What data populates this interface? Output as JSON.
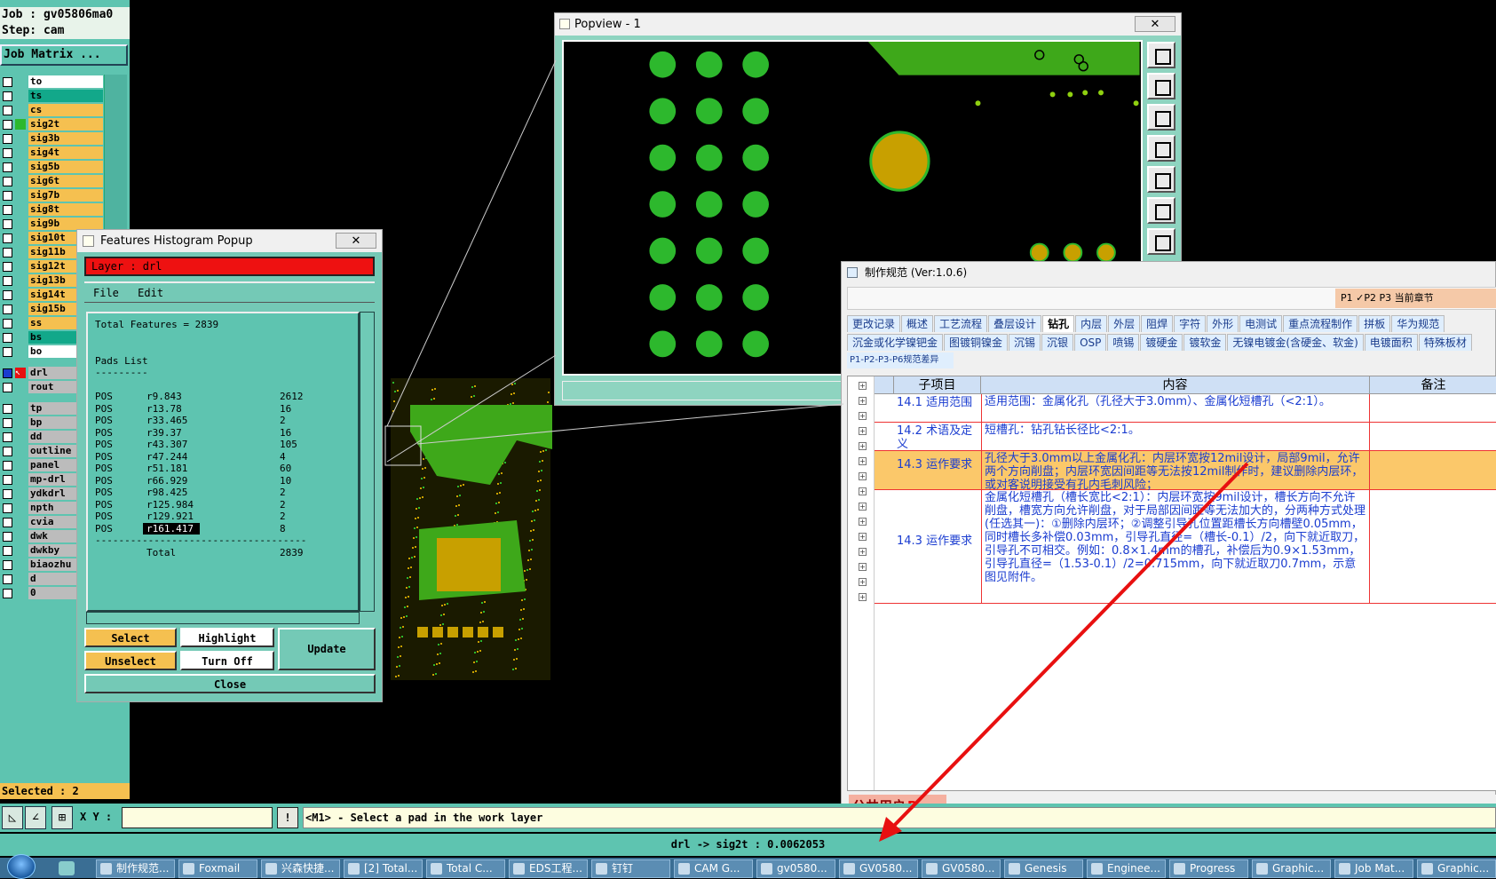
{
  "job": {
    "line1": "Job : gv05806ma0",
    "line2": "Step: cam",
    "matrix_btn": "Job Matrix ..."
  },
  "layers": [
    {
      "name": "to",
      "color": "#ffffff"
    },
    {
      "name": "ts",
      "color": "#12a88a"
    },
    {
      "name": "cs",
      "color": "#f5c050"
    },
    {
      "name": "sig2t",
      "color": "#f5c050"
    },
    {
      "name": "sig3b",
      "color": "#f5c050"
    },
    {
      "name": "sig4t",
      "color": "#f5c050"
    },
    {
      "name": "sig5b",
      "color": "#f5c050"
    },
    {
      "name": "sig6t",
      "color": "#f5c050"
    },
    {
      "name": "sig7b",
      "color": "#f5c050"
    },
    {
      "name": "sig8t",
      "color": "#f5c050"
    },
    {
      "name": "sig9b",
      "color": "#f5c050"
    },
    {
      "name": "sig10t",
      "color": "#f5c050"
    },
    {
      "name": "sig11b",
      "color": "#f5c050"
    },
    {
      "name": "sig12t",
      "color": "#f5c050"
    },
    {
      "name": "sig13b",
      "color": "#f5c050"
    },
    {
      "name": "sig14t",
      "color": "#f5c050"
    },
    {
      "name": "sig15b",
      "color": "#f5c050"
    },
    {
      "name": "ss",
      "color": "#f5c050"
    },
    {
      "name": "bs",
      "color": "#12a88a"
    },
    {
      "name": "bo",
      "color": "#ffffff"
    },
    {
      "name": "",
      "color": "#5ec4b0"
    },
    {
      "name": "drl",
      "color": "#bcbcbc"
    },
    {
      "name": "rout",
      "color": "#bcbcbc"
    },
    {
      "name": "",
      "color": "#5ec4b0"
    },
    {
      "name": "tp",
      "color": "#bcbcbc"
    },
    {
      "name": "bp",
      "color": "#bcbcbc"
    },
    {
      "name": "dd",
      "color": "#bcbcbc"
    },
    {
      "name": "outline",
      "color": "#bcbcbc"
    },
    {
      "name": "panel",
      "color": "#bcbcbc"
    },
    {
      "name": "mp-drl",
      "color": "#bcbcbc"
    },
    {
      "name": "ydkdrl",
      "color": "#bcbcbc"
    },
    {
      "name": "npth",
      "color": "#bcbcbc"
    },
    {
      "name": "cvia",
      "color": "#bcbcbc"
    },
    {
      "name": "dwk",
      "color": "#bcbcbc"
    },
    {
      "name": "dwkby",
      "color": "#bcbcbc"
    },
    {
      "name": "biaozhu",
      "color": "#bcbcbc"
    },
    {
      "name": "d",
      "color": "#bcbcbc"
    },
    {
      "name": "0",
      "color": "#bcbcbc"
    }
  ],
  "selected": "Selected : 2",
  "cmd": {
    "xy_label": "X Y :",
    "xy_value": "",
    "info_btn": "!",
    "prompt": "<M1> - Select a pad in the work layer"
  },
  "status": "drl -> sig2t : 0.0062053",
  "popview": {
    "title": "Popview - 1",
    "close": "✕"
  },
  "hist": {
    "title": "Features Histogram Popup",
    "close": "✕",
    "layer": "Layer :  drl",
    "menu": [
      "File",
      "Edit"
    ],
    "total_features": "Total Features = 2839",
    "pads_title": "Pads List",
    "pads_underline": "---------",
    "rows": [
      {
        "t": "POS",
        "sym": "r9.843",
        "n": "2612"
      },
      {
        "t": "POS",
        "sym": "r13.78",
        "n": "16"
      },
      {
        "t": "POS",
        "sym": "r33.465",
        "n": "2"
      },
      {
        "t": "POS",
        "sym": "r39.37",
        "n": "16"
      },
      {
        "t": "POS",
        "sym": "r43.307",
        "n": "105"
      },
      {
        "t": "POS",
        "sym": "r47.244",
        "n": "4"
      },
      {
        "t": "POS",
        "sym": "r51.181",
        "n": "60"
      },
      {
        "t": "POS",
        "sym": "r66.929",
        "n": "10"
      },
      {
        "t": "POS",
        "sym": "r98.425",
        "n": "2"
      },
      {
        "t": "POS",
        "sym": "r125.984",
        "n": "2"
      },
      {
        "t": "POS",
        "sym": "r129.921",
        "n": "2"
      },
      {
        "t": "POS",
        "sym": "r161.417",
        "n": "8"
      }
    ],
    "divider": "------------------------------------",
    "total_label": "Total",
    "total_value": "2839",
    "btn_select": "Select",
    "btn_unselect": "Unselect",
    "btn_highlight": "Highlight",
    "btn_turnoff": "Turn Off",
    "btn_update": "Update",
    "btn_close": "Close"
  },
  "spec": {
    "title": "制作规范 (Ver:1.0.6)",
    "right_controls": "P1  ✓P2  P3  当前章节",
    "tabs_row1": [
      "更改记录",
      "概述",
      "工艺流程",
      "叠层设计",
      "钻孔",
      "内层",
      "外层",
      "阻焊",
      "字符",
      "外形",
      "电测试",
      "重点流程制作",
      "拼板",
      "华为规范"
    ],
    "active_tab": "钻孔",
    "tabs_row2": [
      "沉金或化学镍钯金",
      "图镀铜镍金",
      "沉锡",
      "沉银",
      "OSP",
      "喷锡",
      "镀硬金",
      "镀软金",
      "无镍电镀金(含硬金、软金)",
      "电镀面积",
      "特殊板材"
    ],
    "p_tab": "P1-P2-P3-P6规范差异",
    "headers": {
      "sub": "子项目",
      "content": "内容",
      "note": "备注"
    },
    "rows": [
      {
        "sub": "14.1 适用范围",
        "content": "适用范围：金属化孔（孔径大于3.0mm）、金属化短槽孔（<2:1）。"
      },
      {
        "sub": "14.2 术语及定义",
        "content": "短槽孔：钻孔钻长径比<2:1。"
      },
      {
        "sub": "14.3 运作要求",
        "content": "孔径大于3.0mm以上金属化孔：内层环宽按12mil设计，局部9mil，允许两个方向削盘；内层环宽因间距等无法按12mil制作时，建议删除内层环，或对客说明接受有孔内毛刺风险；"
      },
      {
        "sub": "14.3 运作要求",
        "content": "金属化短槽孔（槽长宽比<2:1）：内层环宽按9mil设计，槽长方向不允许削盘，槽宽方向允许削盘，对于局部因间距等无法加大的，分两种方式处理(任选其一)：①删除内层环；②调整引导孔位置距槽长方向槽壁0.05mm，同时槽长多补偿0.03mm，引导孔直径=（槽长-0.1）/2，向下就近取刀，引导孔不可相交。例如：0.8×1.4mm的槽孔，补偿后为0.9×1.53mm，引导孔直径=（1.53-0.1）/2=0.715mm，向下就近取刀0.7mm，示意图见附件。"
      }
    ],
    "footer": "公共用户",
    "footer_badge": "R"
  },
  "taskbar": [
    "制作规范...",
    "Foxmail",
    "兴森快捷...",
    "[2] Total...",
    "Total C...",
    "EDS工程...",
    "钉钉",
    "CAM G...",
    "gv0580...",
    "GV0580...",
    "GV0580...",
    "Genesis",
    "Enginee...",
    "Progress",
    "Graphic...",
    "Job Mat...",
    "Graphic..."
  ],
  "colors": {
    "teal": "#5ec4b0",
    "yellow": "#f5c050",
    "green_pad": "#2db82d",
    "gold": "#c8a000",
    "red": "#ee1111"
  }
}
